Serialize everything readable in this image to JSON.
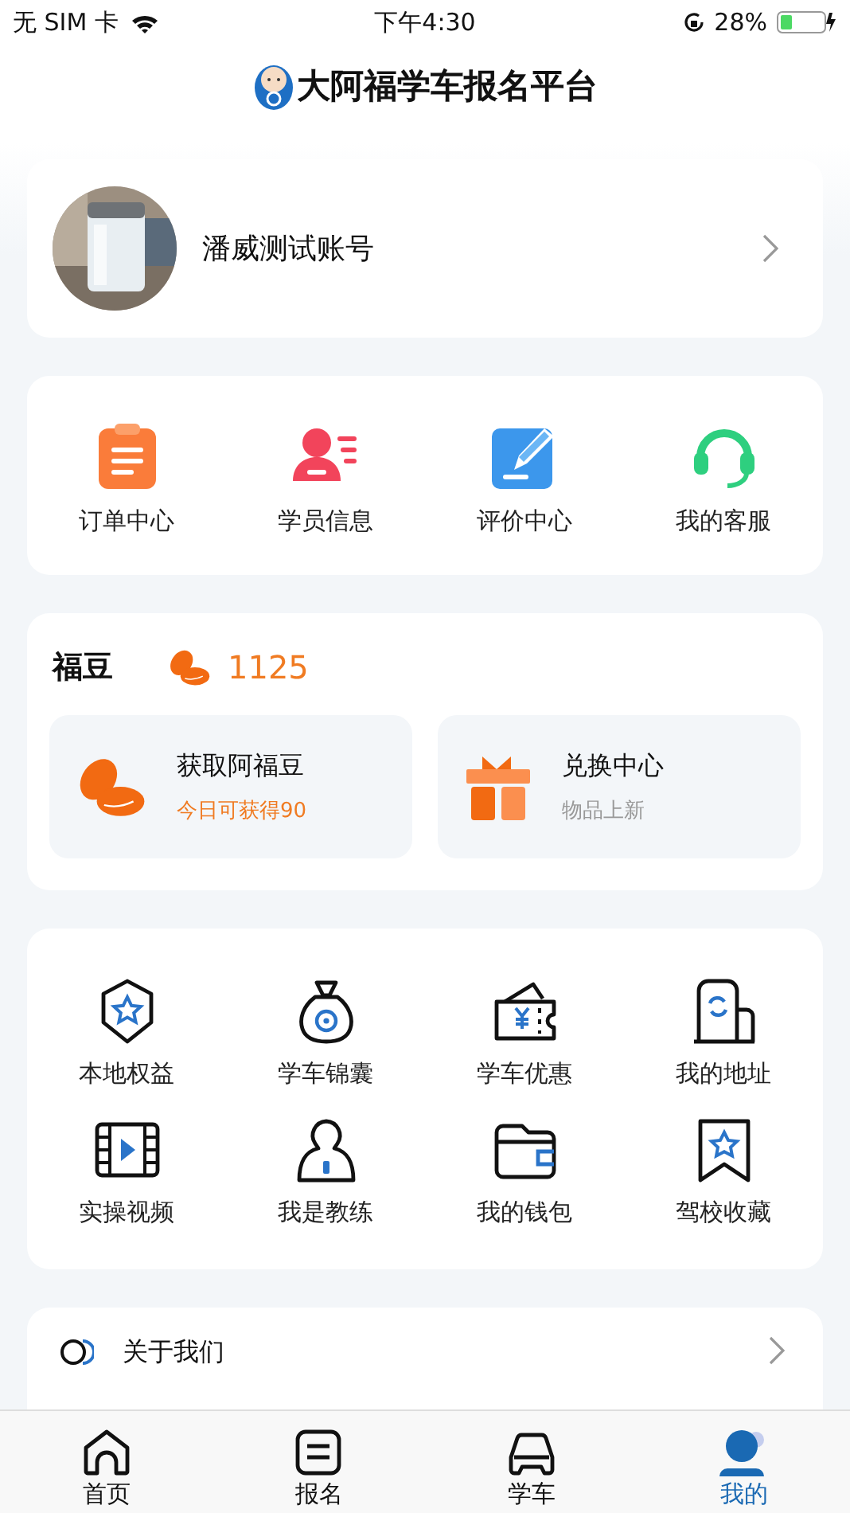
{
  "status_bar": {
    "carrier": "无 SIM 卡",
    "time": "下午4:30",
    "battery": "28%"
  },
  "header": {
    "title": "大阿福学车报名平台"
  },
  "profile": {
    "name": "潘威测试账号"
  },
  "quick_actions": [
    {
      "label": "订单中心",
      "kind": "clipboard"
    },
    {
      "label": "学员信息",
      "kind": "person"
    },
    {
      "label": "评价中心",
      "kind": "edit"
    },
    {
      "label": "我的客服",
      "kind": "headset"
    }
  ],
  "points": {
    "title": "福豆",
    "value": "1125",
    "cards": [
      {
        "title": "获取阿福豆",
        "subtitle": "今日可获得90",
        "kind": "beans"
      },
      {
        "title": "兑换中心",
        "subtitle": "物品上新",
        "kind": "gift"
      }
    ]
  },
  "services": [
    {
      "label": "本地权益",
      "kind": "badge"
    },
    {
      "label": "学车锦囊",
      "kind": "bag"
    },
    {
      "label": "学车优惠",
      "kind": "coupon"
    },
    {
      "label": "我的地址",
      "kind": "building"
    },
    {
      "label": "实操视频",
      "kind": "film"
    },
    {
      "label": "我是教练",
      "kind": "coach"
    },
    {
      "label": "我的钱包",
      "kind": "wallet"
    },
    {
      "label": "驾校收藏",
      "kind": "bookmark"
    }
  ],
  "about": {
    "label": "关于我们"
  },
  "tabs": [
    {
      "label": "首页",
      "kind": "home",
      "selected": false
    },
    {
      "label": "报名",
      "kind": "form",
      "selected": false
    },
    {
      "label": "学车",
      "kind": "car",
      "selected": false
    },
    {
      "label": "我的",
      "kind": "user",
      "selected": true
    }
  ]
}
